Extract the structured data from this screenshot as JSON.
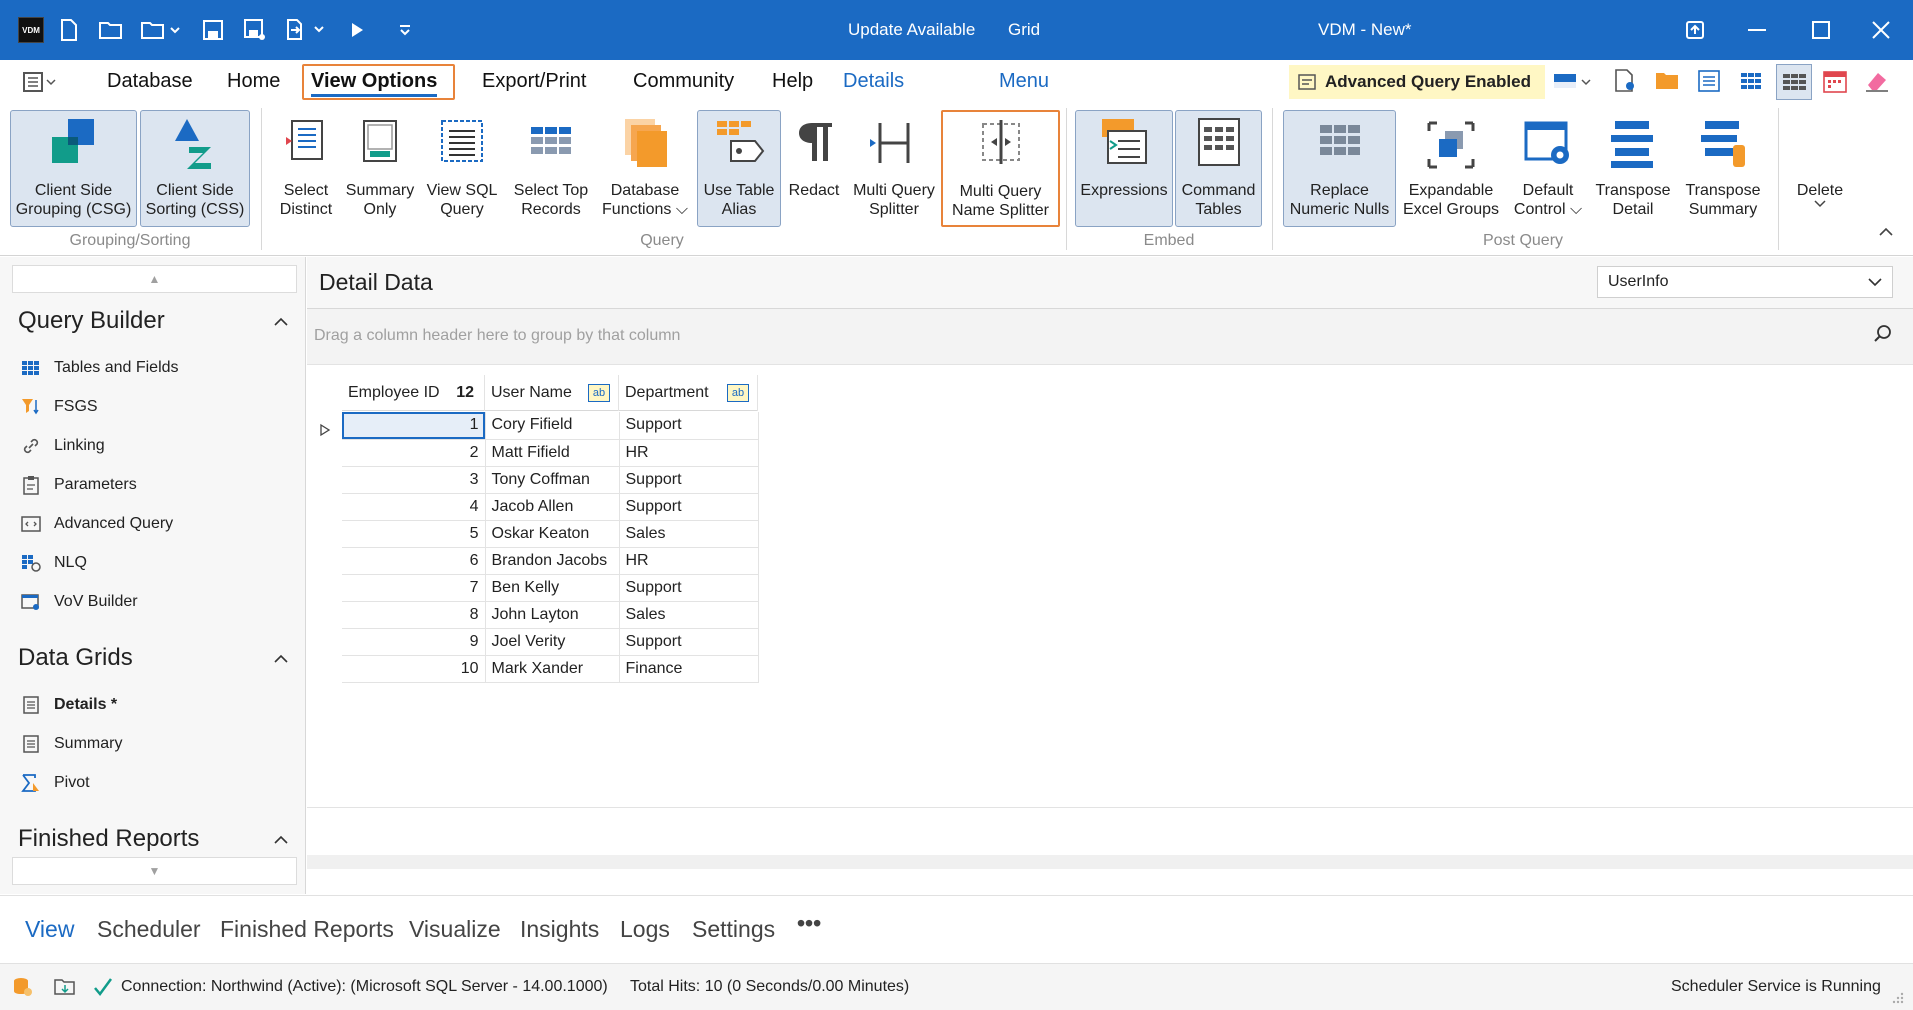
{
  "titlebar": {
    "logo_text": "VDM",
    "update": "Update Available",
    "grid": "Grid",
    "title": "VDM - New*"
  },
  "menubar": {
    "items": [
      "Database",
      "Home",
      "View Options",
      "Export/Print",
      "Community",
      "Help",
      "Details",
      "Menu"
    ],
    "advanced_badge": "Advanced Query Enabled"
  },
  "ribbon": {
    "grouping": {
      "label": "Grouping/Sorting",
      "buttons": [
        "Client Side\nGrouping (CSG)",
        "Client Side\nSorting (CSS)"
      ]
    },
    "query": {
      "label": "Query",
      "buttons": [
        "Select\nDistinct",
        "Summary\nOnly",
        "View SQL\nQuery",
        "Select Top\nRecords",
        "Database\nFunctions ⌵",
        "Use Table\nAlias",
        "Redact",
        "Multi Query\nSplitter",
        "Multi Query\nName Splitter"
      ]
    },
    "embed": {
      "label": "Embed",
      "buttons": [
        "Expressions",
        "Command\nTables"
      ]
    },
    "post": {
      "label": "Post Query",
      "buttons": [
        "Replace\nNumeric Nulls",
        "Expandable\nExcel Groups",
        "Default\nControl ⌵",
        "Transpose\nDetail",
        "Transpose\nSummary"
      ]
    },
    "delete": "Delete"
  },
  "sidebar": {
    "query_builder": {
      "title": "Query Builder",
      "items": [
        "Tables and Fields",
        "FSGS",
        "Linking",
        "Parameters",
        "Advanced Query",
        "NLQ",
        "VoV Builder"
      ]
    },
    "data_grids": {
      "title": "Data Grids",
      "items": [
        "Details *",
        "Summary",
        "Pivot"
      ]
    },
    "finished_reports": {
      "title": "Finished Reports"
    }
  },
  "main": {
    "title": "Detail Data",
    "table_select": "UserInfo",
    "group_hint": "Drag a column header here to group by that column",
    "columns": [
      "Employee ID",
      "User Name",
      "Department"
    ],
    "count": "12",
    "ab_badge": "ab",
    "rows": [
      [
        "1",
        "Cory Fifield",
        "Support"
      ],
      [
        "2",
        "Matt Fifield",
        "HR"
      ],
      [
        "3",
        "Tony Coffman",
        "Support"
      ],
      [
        "4",
        "Jacob Allen",
        "Support"
      ],
      [
        "5",
        "Oskar Keaton",
        "Sales"
      ],
      [
        "6",
        "Brandon Jacobs",
        "HR"
      ],
      [
        "7",
        "Ben Kelly",
        "Support"
      ],
      [
        "8",
        "John Layton",
        "Sales"
      ],
      [
        "9",
        "Joel Verity",
        "Support"
      ],
      [
        "10",
        "Mark Xander",
        "Finance"
      ]
    ]
  },
  "bottom_tabs": [
    "View",
    "Scheduler",
    "Finished Reports",
    "Visualize",
    "Insights",
    "Logs",
    "Settings",
    "•••"
  ],
  "status": {
    "connection": "Connection: Northwind (Active): (Microsoft SQL Server - 14.00.1000)",
    "hits": "Total Hits: 10 (0 Seconds/0.00 Minutes)",
    "scheduler": "Scheduler Service is Running"
  },
  "colors": {
    "titlebar": "#1b6ac3",
    "accent": "#1b6ac3",
    "highlight_outline": "#e8833a",
    "badge_bg": "#fff7c4"
  }
}
